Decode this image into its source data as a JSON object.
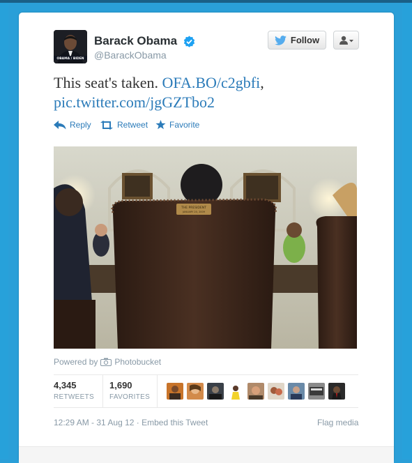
{
  "tweet": {
    "user": {
      "name": "Barack Obama",
      "handle": "@BarackObama",
      "avatar_caption": "OBAMA / BIDEN",
      "verified_icon": "verified-badge-icon"
    },
    "follow_label": "Follow",
    "text": "This seat's taken.",
    "link1": "OFA.BO/c2gbfi",
    "after_link": ",",
    "link2": "pic.twitter.com/jgGZTbo2",
    "actions": {
      "reply": "Reply",
      "retweet": "Retweet",
      "favorite": "Favorite"
    },
    "photo": {
      "plaque_line1": "THE PRESIDENT",
      "plaque_line2": "JANUARY 20, 2009"
    },
    "powered_by_prefix": "Powered by",
    "powered_by_brand": "Photobucket",
    "stats": {
      "retweets_count": "4,345",
      "retweets_label": "RETWEETS",
      "favorites_count": "1,690",
      "favorites_label": "FAVORITES"
    },
    "timestamp": "12:29 AM - 31 Aug 12",
    "separator": "·",
    "embed_label": "Embed this Tweet",
    "flag_label": "Flag media"
  },
  "colors": {
    "page_bg": "#2a9fd8",
    "link_blue": "#2b7bb9",
    "verified_blue": "#1da1f2",
    "muted": "#8899a6"
  }
}
